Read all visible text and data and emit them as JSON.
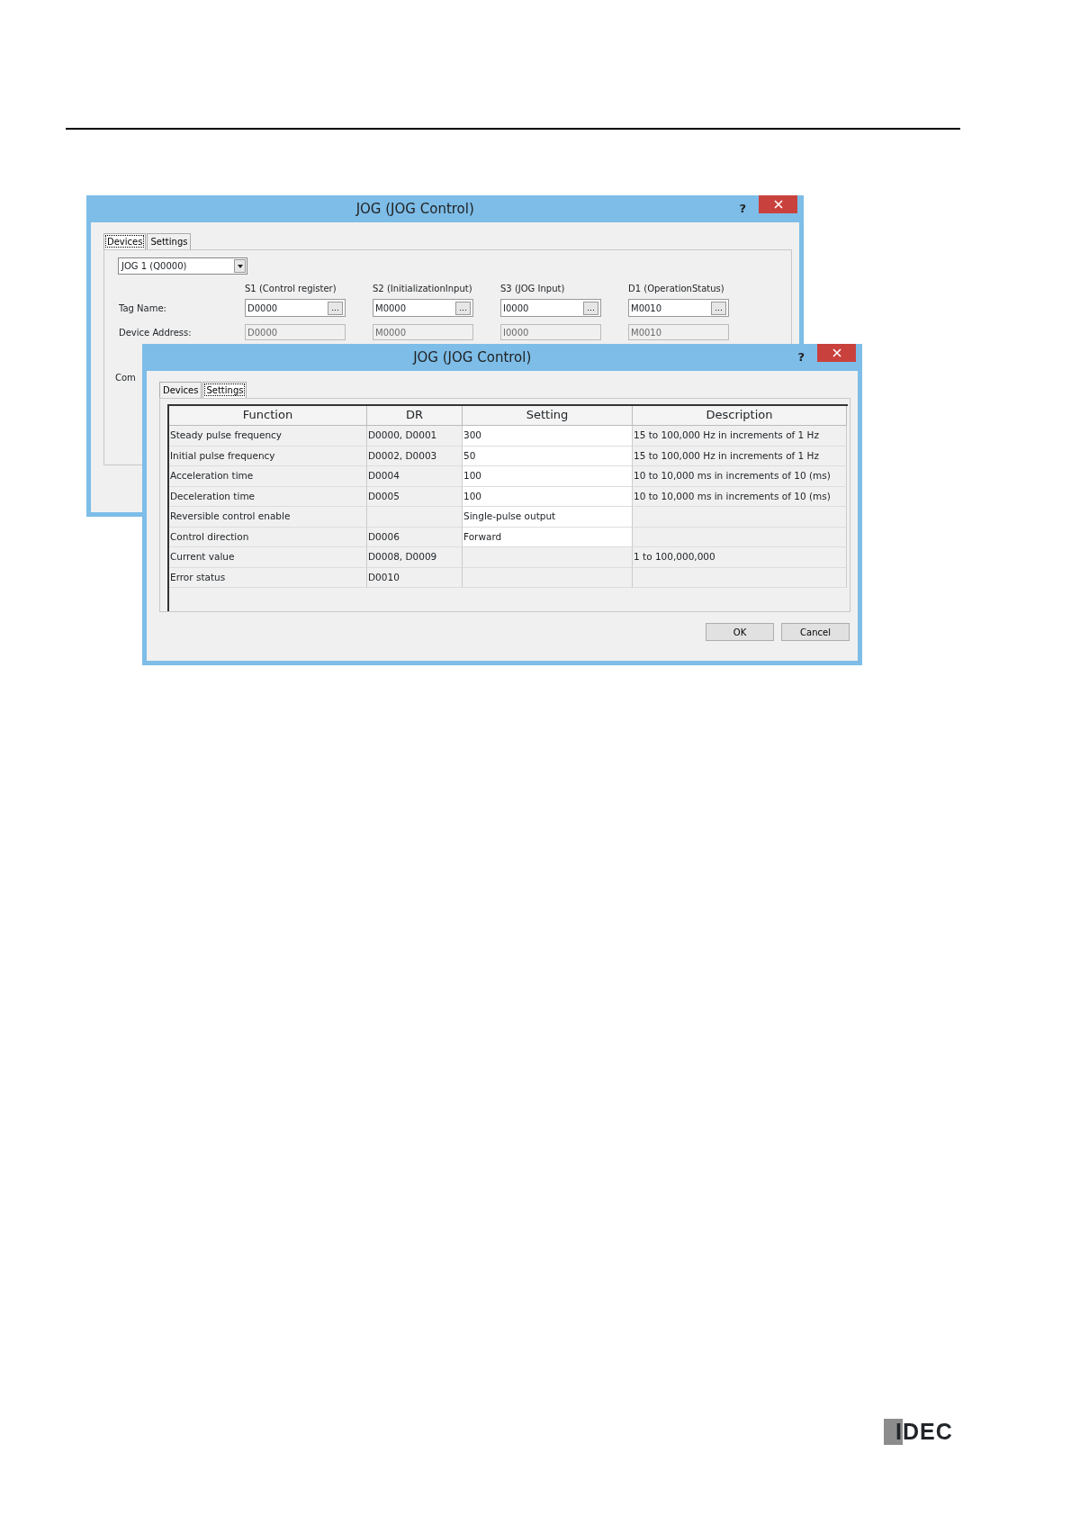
{
  "dialogs": [
    {
      "title": "JOG (JOG Control)",
      "help": "?",
      "tabs": [
        {
          "label": "Devices",
          "selected": true
        },
        {
          "label": "Settings",
          "selected": false
        }
      ],
      "combo": "JOG 1 (Q0000)",
      "columns": [
        "S1 (Control register)",
        "S2 (InitializationInput)",
        "S3 (JOG Input)",
        "D1 (OperationStatus)"
      ],
      "rows": [
        {
          "label": "Tag Name:",
          "kind": "editable",
          "fields": [
            {
              "value": "D0000",
              "browse": "..."
            },
            {
              "value": "M0000",
              "browse": "..."
            },
            {
              "value": "I0000",
              "browse": "..."
            },
            {
              "value": "M0010",
              "browse": "..."
            }
          ]
        },
        {
          "label": "Device Address:",
          "kind": "readonly",
          "fields": [
            {
              "value": "D0000"
            },
            {
              "value": "M0000"
            },
            {
              "value": "I0000"
            },
            {
              "value": "M0010"
            }
          ]
        }
      ],
      "cut_label": "Com"
    },
    {
      "title": "JOG (JOG Control)",
      "help": "?",
      "tabs": [
        {
          "label": "Devices",
          "selected": false
        },
        {
          "label": "Settings",
          "selected": true
        }
      ],
      "table": {
        "columns": [
          "Function",
          "DR",
          "Setting",
          "Description"
        ],
        "rows": [
          {
            "function": "Steady pulse frequency",
            "dr": "D0000, D0001",
            "setting": "300",
            "description": "15 to 100,000 Hz in increments of 1 Hz"
          },
          {
            "function": "Initial pulse frequency",
            "dr": "D0002, D0003",
            "setting": "50",
            "description": "15 to 100,000 Hz in increments of 1 Hz"
          },
          {
            "function": "Acceleration time",
            "dr": "D0004",
            "setting": "100",
            "description": "10 to 10,000 ms in increments of 10 (ms)"
          },
          {
            "function": "Deceleration time",
            "dr": "D0005",
            "setting": "100",
            "description": "10 to 10,000 ms in increments of 10 (ms)"
          },
          {
            "function": "Reversible control enable",
            "dr": "",
            "setting": "Single-pulse output",
            "description": ""
          },
          {
            "function": "Control direction",
            "dr": "D0006",
            "setting": "Forward",
            "description": ""
          },
          {
            "function": "Current value",
            "dr": "D0008, D0009",
            "setting": "",
            "description": "1 to 100,000,000"
          },
          {
            "function": "Error status",
            "dr": "D0010",
            "setting": "",
            "description": ""
          }
        ]
      },
      "buttons": [
        "OK",
        "Cancel"
      ]
    }
  ],
  "logo": "IDEC"
}
